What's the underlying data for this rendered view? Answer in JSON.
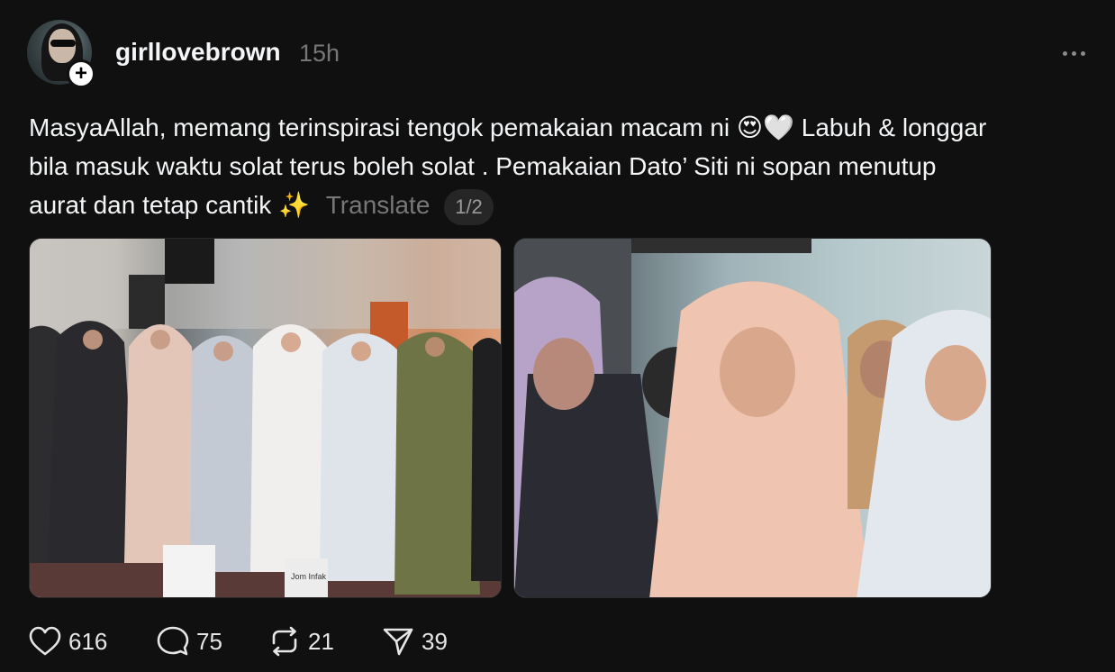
{
  "post": {
    "username": "girllovebrown",
    "timestamp": "15h",
    "text_line1": "MasyaAllah, memang terinspirasi tengok pemakaian macam ni ",
    "text_emoji1": "😍🤍",
    "text_line1b": " Labuh & longgar",
    "text_line2": "bila masuk waktu solat terus boleh solat . Pemakaian Dato’ Siti ni sopan menutup",
    "text_line3": "aurat dan tetap cantik ",
    "text_emoji2": "✨",
    "translate_label": "Translate",
    "page_indicator": "1/2",
    "image1_sign_text": "Jom Infak"
  },
  "actions": {
    "likes": "616",
    "comments": "75",
    "reposts": "21",
    "shares": "39"
  },
  "icons": {
    "like": "heart-icon",
    "comment": "comment-bubble-icon",
    "repost": "repost-icon",
    "share": "send-icon",
    "more": "more-horizontal-icon",
    "follow": "plus-icon"
  }
}
